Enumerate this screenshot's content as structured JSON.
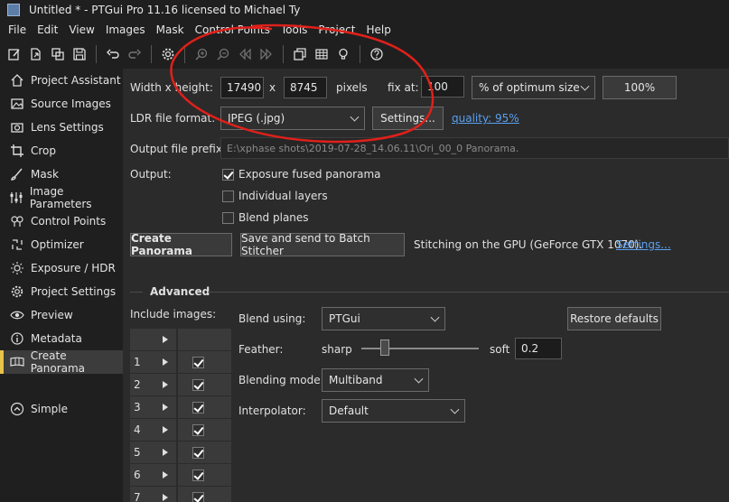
{
  "window": {
    "title": "Untitled * - PTGui Pro 11.16 licensed to Michael Ty"
  },
  "menu": [
    "File",
    "Edit",
    "View",
    "Images",
    "Mask",
    "Control Points",
    "Tools",
    "Project",
    "Help"
  ],
  "toolbar": {
    "icons": [
      "new-project-icon",
      "open-icon",
      "duplicate-icon",
      "save-icon",
      "undo-icon",
      "redo-icon",
      "settings-gear-icon",
      "zoom-in-icon",
      "zoom-out-icon",
      "previous-icon",
      "next-icon",
      "panorama-editor-icon",
      "table-icon",
      "lightbulb-icon",
      "help-icon"
    ]
  },
  "sidebar": {
    "items": [
      {
        "label": "Project Assistant",
        "icon": "house-icon"
      },
      {
        "label": "Source Images",
        "icon": "images-icon"
      },
      {
        "label": "Lens Settings",
        "icon": "camera-icon"
      },
      {
        "label": "Crop",
        "icon": "crop-icon"
      },
      {
        "label": "Mask",
        "icon": "brush-icon"
      },
      {
        "label": "Image Parameters",
        "icon": "sliders-icon"
      },
      {
        "label": "Control Points",
        "icon": "pin-icon"
      },
      {
        "label": "Optimizer",
        "icon": "optimizer-icon"
      },
      {
        "label": "Exposure / HDR",
        "icon": "sun-icon"
      },
      {
        "label": "Project Settings",
        "icon": "gear-icon"
      },
      {
        "label": "Preview",
        "icon": "eye-icon"
      },
      {
        "label": "Metadata",
        "icon": "info-icon"
      },
      {
        "label": "Create Panorama",
        "icon": "panorama-icon"
      }
    ],
    "simple": {
      "label": "Simple",
      "icon": "chevron-up-circle-icon"
    }
  },
  "form": {
    "width_height_label": "Width x height:",
    "width": "17490",
    "x_sep": "x",
    "height": "8745",
    "pixels_label": "pixels",
    "fix_at_label": "fix at:",
    "fix_at_value": "100",
    "size_mode": "% of optimum size",
    "percent_button": "100%",
    "ldr_label": "LDR file format:",
    "ldr_format": "JPEG (.jpg)",
    "settings_button": "Settings...",
    "quality_link": "quality: 95%",
    "prefix_label": "Output file prefix:",
    "prefix_value": "E:\\xphase shots\\2019-07-28_14.06.11\\Ori_00_0 Panorama.",
    "output_label": "Output:",
    "outputs": [
      {
        "label": "Exposure fused panorama",
        "checked": true
      },
      {
        "label": "Individual layers",
        "checked": false
      },
      {
        "label": "Blend planes",
        "checked": false
      }
    ],
    "create_button": "Create Panorama",
    "batch_button": "Save and send to Batch Stitcher",
    "gpu_text": "Stitching on the GPU (GeForce GTX 1070).",
    "gpu_settings_link": "Settings..."
  },
  "advanced": {
    "title": "Advanced",
    "include_label": "Include images:",
    "images": [
      {
        "num": "",
        "checked": false
      },
      {
        "num": "1",
        "checked": true
      },
      {
        "num": "2",
        "checked": true
      },
      {
        "num": "3",
        "checked": true
      },
      {
        "num": "4",
        "checked": true
      },
      {
        "num": "5",
        "checked": true
      },
      {
        "num": "6",
        "checked": true
      },
      {
        "num": "7",
        "checked": true
      }
    ],
    "blend_label": "Blend using:",
    "blend_value": "PTGui",
    "restore_button": "Restore defaults",
    "feather_label": "Feather:",
    "sharp_label": "sharp",
    "soft_label": "soft",
    "feather_value": "0.2",
    "feather_level": 0.2,
    "blending_mode_label": "Blending mode:",
    "blending_mode_value": "Multiband",
    "interpolator_label": "Interpolator:",
    "interpolator_value": "Default"
  },
  "colors": {
    "annotation": "#e0201a",
    "active_marker": "#e8c34a",
    "link": "#5aa0f0"
  }
}
